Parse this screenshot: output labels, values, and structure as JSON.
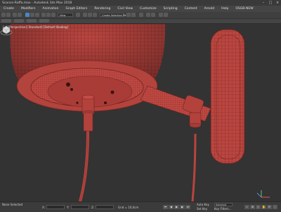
{
  "window": {
    "title": "Sconce-Raffa.max - Autodesk 3ds Max 2018",
    "buttons": {
      "minimize": "–",
      "maximize": "□",
      "close": "×"
    }
  },
  "menu": {
    "items": [
      "Create",
      "Modifiers",
      "Animation",
      "Graph Editors",
      "Rendering",
      "Civil View",
      "Customize",
      "Scripting",
      "Content",
      "Arnold",
      "Help",
      "OSGB-NEW"
    ]
  },
  "toolbar": {
    "selection_set_placeholder": "Create Selection Se",
    "view_dropdown": "View"
  },
  "viewport": {
    "label": "[+] [Perspective] [Standard] [Default Shading]",
    "viewcube_icon": "viewcube-icon"
  },
  "status": {
    "selection": "None Selected",
    "x_label": "X:",
    "y_label": "Y:",
    "z_label": "Z:",
    "grid": "Grid = 10,0cm",
    "autokey": "Auto Key",
    "setkey": "Set Key",
    "selected": "Selected",
    "key_filters": "Key Filters..."
  },
  "colors": {
    "wire": "#c0473f",
    "wire_dark": "#9c3530",
    "background": "#333333"
  }
}
